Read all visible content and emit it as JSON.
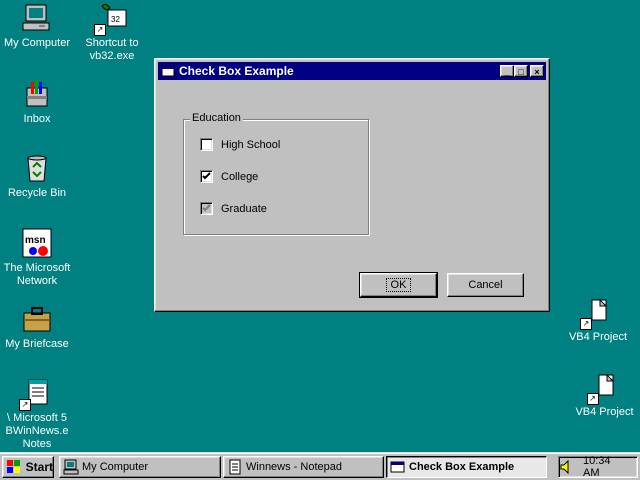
{
  "desktop": {
    "icons": [
      {
        "label": "My Computer"
      },
      {
        "label": "Shortcut to\nvb32.exe"
      },
      {
        "label": "Inbox"
      },
      {
        "label": "Recycle Bin"
      },
      {
        "label": "The Microsoft\nNetwork"
      },
      {
        "label": "My Briefcase"
      },
      {
        "label": "\\ Microsoft 5\nBWinNews.e\nNotes"
      },
      {
        "label": "VB4 Project"
      },
      {
        "label": "VB4 Project"
      }
    ]
  },
  "dialog": {
    "title": "Check Box Example",
    "title_buttons": {
      "minimize": "_",
      "maximize": "□",
      "close": "×"
    },
    "group_label": "Education",
    "checkboxes": [
      {
        "label": "High School",
        "checked": false,
        "enabled": true
      },
      {
        "label": "College",
        "checked": true,
        "enabled": true
      },
      {
        "label": "Graduate",
        "checked": true,
        "enabled": false
      }
    ],
    "ok_label": "OK",
    "cancel_label": "Cancel"
  },
  "taskbar": {
    "start_label": "Start",
    "tasks": [
      {
        "label": "My Computer",
        "active": false
      },
      {
        "label": "Winnews - Notepad",
        "active": false
      },
      {
        "label": "Check Box Example",
        "active": true
      }
    ],
    "clock": "10:34 AM"
  },
  "colors": {
    "desktop": "#008080",
    "titlebar": "#000080",
    "face": "#c0c0c0"
  }
}
